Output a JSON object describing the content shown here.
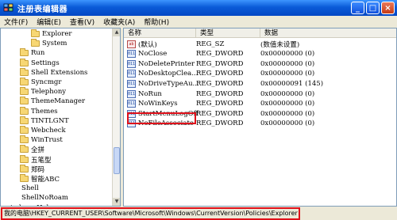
{
  "window": {
    "title": "注册表编辑器",
    "minimize_label": "_",
    "maximize_label": "□",
    "close_label": "×"
  },
  "menu": [
    "文件(F)",
    "编辑(E)",
    "查看(V)",
    "收藏夹(A)",
    "帮助(H)"
  ],
  "tree": [
    {
      "label": "Explorer",
      "indent": 1
    },
    {
      "label": "System",
      "indent": 1
    },
    {
      "label": "Run",
      "indent": 0
    },
    {
      "label": "Settings",
      "indent": 0
    },
    {
      "label": "Shell Extensions",
      "indent": 0
    },
    {
      "label": "Syncmgr",
      "indent": 0
    },
    {
      "label": "Telephony",
      "indent": 0
    },
    {
      "label": "ThemeManager",
      "indent": 0
    },
    {
      "label": "Themes",
      "indent": 0
    },
    {
      "label": "TINTLGNT",
      "indent": 0
    },
    {
      "label": "Webcheck",
      "indent": 0
    },
    {
      "label": "WinTrust",
      "indent": 0
    },
    {
      "label": "全拼",
      "indent": 0
    },
    {
      "label": "五笔型",
      "indent": 0
    },
    {
      "label": "郑码",
      "indent": 0
    },
    {
      "label": "智能ABC",
      "indent": 0
    },
    {
      "label": "Shell",
      "indent": -1
    },
    {
      "label": "ShellNoRoam",
      "indent": -1
    },
    {
      "label": "indows Help",
      "indent": -2
    }
  ],
  "columns": {
    "name": "名称",
    "type": "类型",
    "data": "数据"
  },
  "values": [
    {
      "name": "(默认)",
      "type": "REG_SZ",
      "data": "(数值未设置)",
      "kind": "sz"
    },
    {
      "name": "NoClose",
      "type": "REG_DWORD",
      "data": "0x00000000 (0)",
      "kind": "dword"
    },
    {
      "name": "NoDeletePrinter",
      "type": "REG_DWORD",
      "data": "0x00000000 (0)",
      "kind": "dword"
    },
    {
      "name": "NoDesktopClea...",
      "type": "REG_DWORD",
      "data": "0x00000000 (0)",
      "kind": "dword"
    },
    {
      "name": "NoDriveTypeAu...",
      "type": "REG_DWORD",
      "data": "0x00000091 (145)",
      "kind": "dword"
    },
    {
      "name": "NoRun",
      "type": "REG_DWORD",
      "data": "0x00000000 (0)",
      "kind": "dword"
    },
    {
      "name": "NoWinKeys",
      "type": "REG_DWORD",
      "data": "0x00000000 (0)",
      "kind": "dword"
    },
    {
      "name": "StartMenuLogOff",
      "type": "REG_DWORD",
      "data": "0x00000000 (0)",
      "kind": "dword"
    },
    {
      "name": "NoFileAssociate",
      "type": "REG_DWORD",
      "data": "0x00000000 (0)",
      "kind": "dword"
    }
  ],
  "status": {
    "path": "我的电脑\\HKEY_CURRENT_USER\\Software\\Microsoft\\Windows\\CurrentVersion\\Policies\\Explorer"
  },
  "colors": {
    "highlight": "#e0101a",
    "titlebar": "#0a5bd8"
  }
}
